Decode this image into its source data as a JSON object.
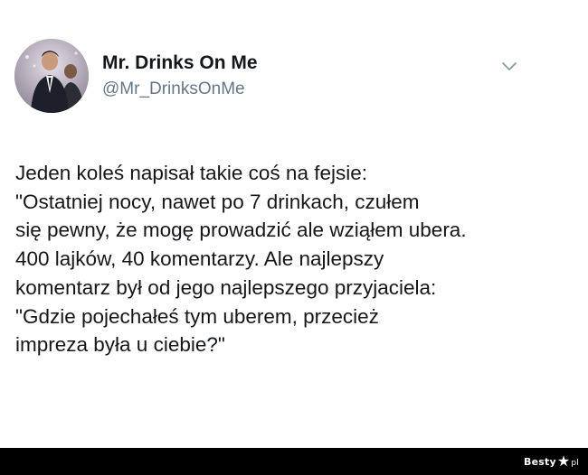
{
  "tweet": {
    "display_name": "Mr. Drinks On Me",
    "handle": "@Mr_DrinksOnMe",
    "avatar_icon": "profile-photo",
    "menu_icon": "chevron-down-icon",
    "text_lines": [
      "Jeden koleś napisał takie coś na fejsie:",
      "\"Ostatniej nocy, nawet po 7 drinkach, czułem",
      "się pewny, że mogę prowadzić ale wziąłem ubera.",
      "400 lajków, 40 komentarzy. Ale najlepszy",
      "komentarz był od jego najlepszego przyjaciela:",
      "\"Gdzie pojechałeś tym uberem, przecież",
      "impreza była u ciebie?\""
    ]
  },
  "watermark": {
    "brand_prefix": "Besty",
    "brand_suffix": "pl",
    "icon": "star-icon"
  },
  "colors": {
    "text": "#14171a",
    "secondary_text": "#657786",
    "footer_bg": "#000000"
  }
}
